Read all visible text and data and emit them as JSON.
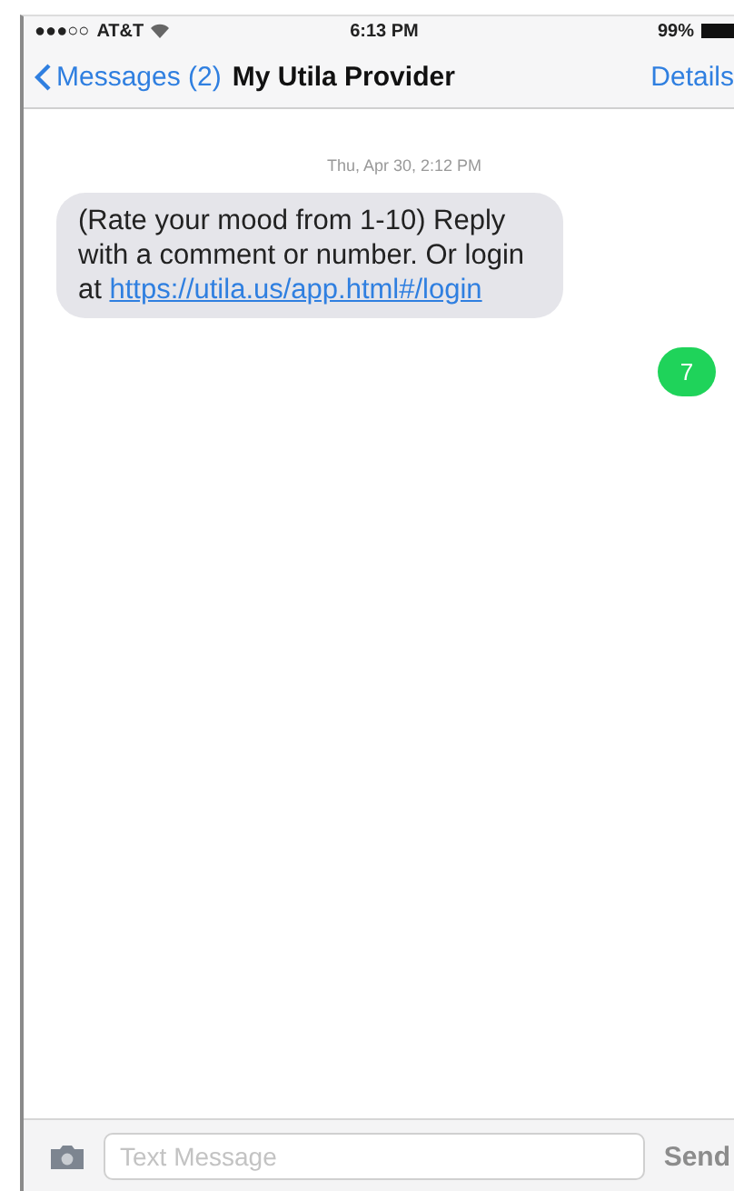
{
  "status_bar": {
    "signal": "●●●○○",
    "carrier": "AT&T",
    "time": "6:13 PM",
    "battery": "99%"
  },
  "nav": {
    "back": "Messages (2)",
    "title": "My Utila Provider",
    "action": "Details"
  },
  "timestamp": "Thu, Apr 30, 2:12 PM",
  "messages": [
    {
      "kind": "incoming",
      "text": "(Rate your mood from 1-10) Reply with a comment or number.  Or login at ",
      "link": "https://utila.us/app.html#/login"
    },
    {
      "kind": "outgoing",
      "text": "7"
    }
  ],
  "composer": {
    "placeholder": "Text Message",
    "send": "Send"
  }
}
